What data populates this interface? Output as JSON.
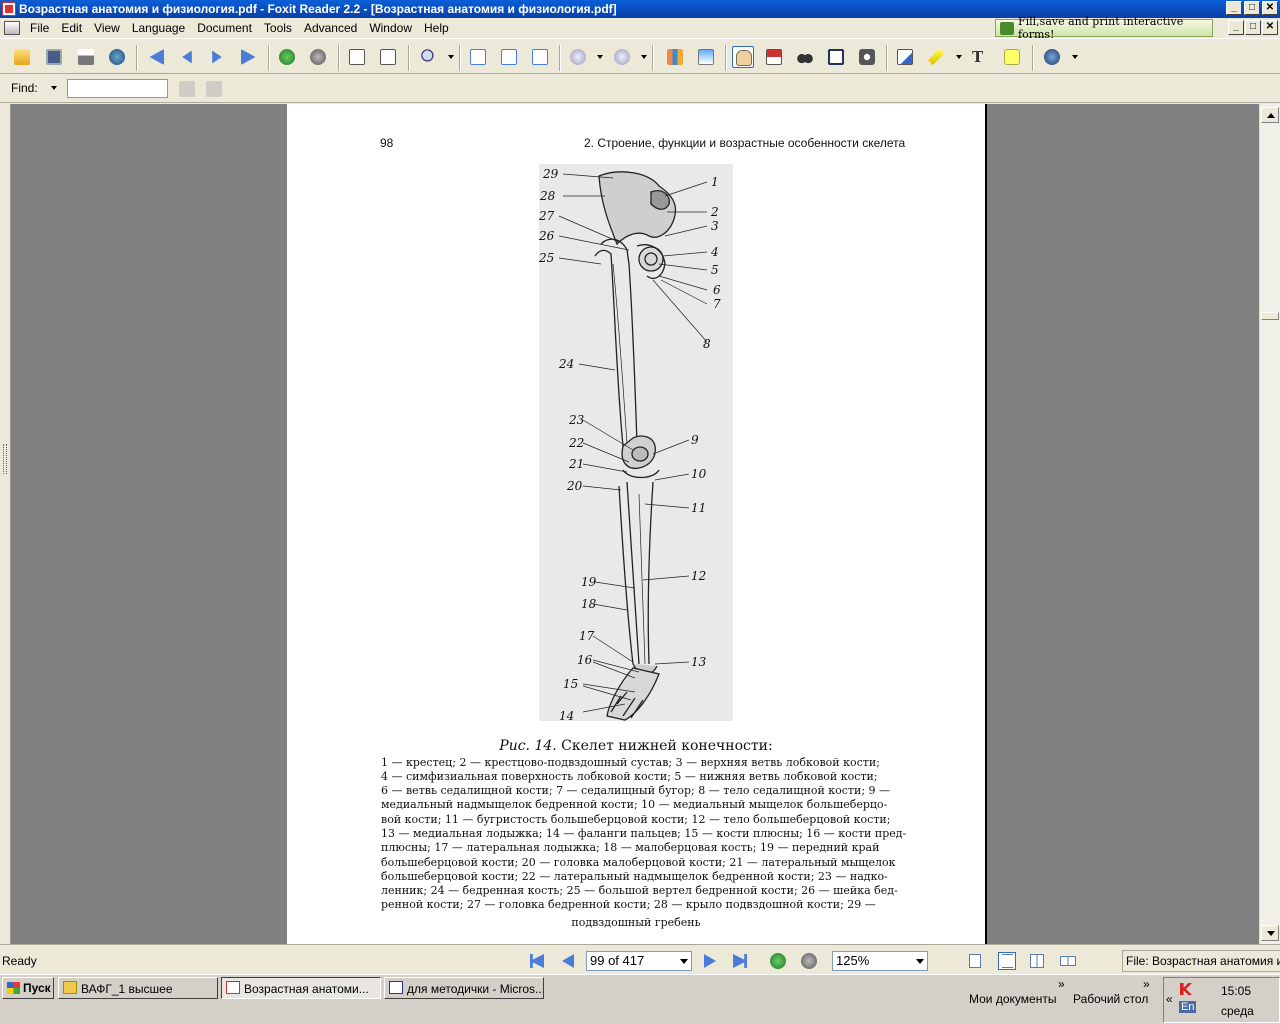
{
  "window": {
    "title": "Возрастная анатомия и физиология.pdf - Foxit Reader 2.2 - [Возрастная анатомия и физиология.pdf]",
    "controls": {
      "minimize": "_",
      "maximize": "□",
      "close": "✕"
    }
  },
  "menu": {
    "items": [
      "File",
      "Edit",
      "View",
      "Language",
      "Document",
      "Tools",
      "Advanced",
      "Window",
      "Help"
    ],
    "fill_button": "Fill,save and print interactive forms!"
  },
  "find": {
    "label": "Find:",
    "value": ""
  },
  "toolbar": {
    "icons": [
      "open-icon",
      "save-icon",
      "print-icon",
      "email-icon",
      "first-page-icon",
      "prev-page-icon",
      "next-page-icon",
      "last-page-icon",
      "back-icon",
      "forward-icon",
      "rotate-left-icon",
      "rotate-right-icon",
      "zoom-icon",
      "actual-size-icon",
      "fit-page-icon",
      "fit-width-icon",
      "zoom-out-icon",
      "zoom-in-icon",
      "bookmark-icon",
      "snapshot-icon",
      "hand-tool-icon",
      "select-text-icon",
      "find-icon",
      "typewriter-icon",
      "camera-icon",
      "note-icon",
      "highlight-icon",
      "text-icon",
      "comment-icon",
      "info-icon"
    ]
  },
  "document": {
    "page_number": "98",
    "running_header": "2. Строение, функции и возрастные особенности скелета",
    "figure_labels_left": [
      "29",
      "28",
      "27",
      "26",
      "25",
      "24",
      "23",
      "22",
      "21",
      "20",
      "19",
      "18",
      "17",
      "16",
      "15",
      "14"
    ],
    "figure_labels_right": [
      "1",
      "2",
      "3",
      "4",
      "5",
      "6",
      "7",
      "8",
      "9",
      "10",
      "11",
      "12",
      "13"
    ],
    "caption_title_italic": "Рис. 14.",
    "caption_title": " Скелет нижней конечности:",
    "caption_lines": [
      "1 — крестец; 2 — крестцово-подвздошный сустав; 3 — верхняя ветвь лобковой кости;",
      "4 — симфизиальная поверхность лобковой кости; 5 — нижняя ветвь лобковой кости;",
      "6 — ветвь седалищной кости; 7 — седалищный бугор; 8 — тело седалищной кости; 9 —",
      "медиальный надмыщелок бедренной кости; 10 — медиальный мыщелок большеберцо-",
      "вой кости; 11 — бугристость большеберцовой кости; 12 — тело большеберцовой кости;",
      "13 — медиальная лодыжка; 14 — фаланги пальцев; 15 — кости плюсны; 16 — кости пред-",
      "плюсны; 17 — латеральная лодыжка; 18 — малоберцовая кость; 19 — передний край",
      "большеберцовой кости; 20 — головка малоберцовой кости; 21 — латеральный мыщелок",
      "большеберцовой кости; 22 — латеральный надмыщелок бедренной кости; 23 — надко-",
      "ленник; 24 — бедренная кость; 25 — большой вертел бедренной кости; 26 — шейка бед-",
      "ренной кости; 27 — головка бедренной кости; 28 — крыло подвздошной кости; 29 —"
    ],
    "caption_last": "подвздошный гребень"
  },
  "status": {
    "ready": "Ready",
    "page": "99 of 417",
    "zoom": "125%",
    "file": "File: Возрастная анатомия и физиол"
  },
  "taskbar": {
    "start": "Пуск",
    "tasks": [
      "ВАФГ_1 высшее",
      "Возрастная анатоми...",
      "для методички - Micros..."
    ],
    "quick_docs": "Мои документы",
    "quick_desktop": "Рабочий стол",
    "chevron": "»",
    "tray_chevron": "«",
    "lang": "En",
    "time": "15:05",
    "day": "среда"
  }
}
